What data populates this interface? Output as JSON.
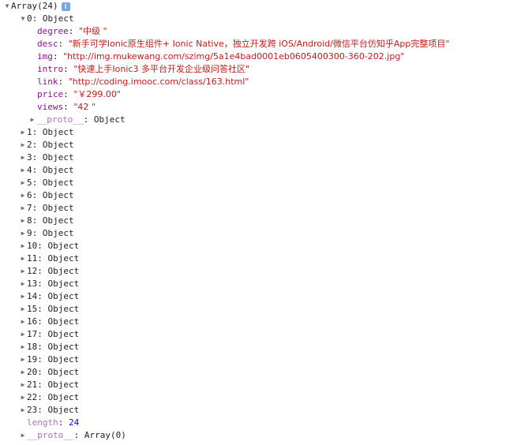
{
  "root": {
    "label": "Array(24)",
    "info_icon": "info-icon"
  },
  "item0": {
    "label": "0: Object",
    "props": [
      {
        "key": "degree",
        "value": "\"中级 \""
      },
      {
        "key": "desc",
        "value": "\"新手可学Ionic原生组件+ Ionic Native，独立开发跨 iOS/Android/微信平台仿知乎App完整项目\""
      },
      {
        "key": "img",
        "value": "\"http://img.mukewang.com/szimg/5a1e4bad0001eb0605400300-360-202.jpg\""
      },
      {
        "key": "intro",
        "value": "\"快速上手Ionic3 多平台开发企业级问答社区\""
      },
      {
        "key": "link",
        "value": "\"http://coding.imooc.com/class/163.html\""
      },
      {
        "key": "price",
        "value": "\"￥299.00\""
      },
      {
        "key": "views",
        "value": "\"42 \""
      }
    ],
    "proto_key": "__proto__",
    "proto_value": "Object"
  },
  "items": [
    "1: Object",
    "2: Object",
    "3: Object",
    "4: Object",
    "5: Object",
    "6: Object",
    "7: Object",
    "8: Object",
    "9: Object",
    "10: Object",
    "11: Object",
    "12: Object",
    "13: Object",
    "14: Object",
    "15: Object",
    "16: Object",
    "17: Object",
    "18: Object",
    "19: Object",
    "20: Object",
    "21: Object",
    "22: Object",
    "23: Object"
  ],
  "length": {
    "key": "length",
    "value": "24"
  },
  "root_proto": {
    "key": "__proto__",
    "value": "Array(0)"
  },
  "colors": {
    "key": "#881391",
    "string": "#c41a16",
    "number": "#1c00cf"
  }
}
